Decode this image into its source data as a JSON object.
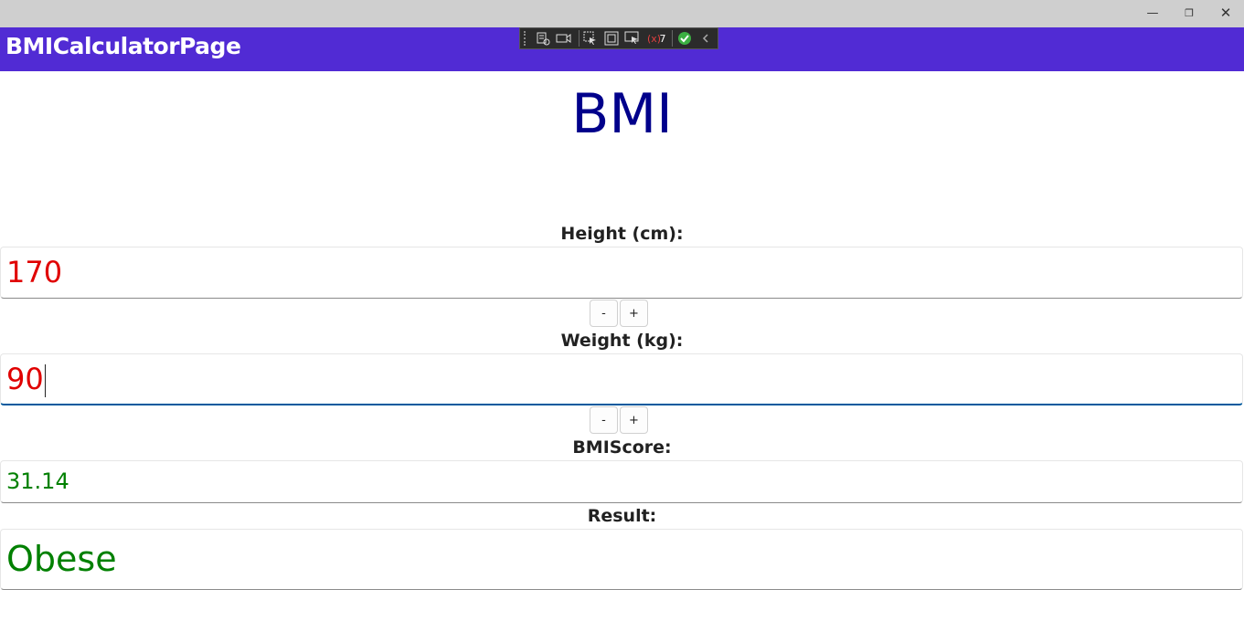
{
  "window": {
    "minimize_glyph": "—",
    "restore_glyph": "❐",
    "close_glyph": "✕"
  },
  "navbar": {
    "title": "BMICalculatorPage"
  },
  "devtools": {
    "binding_failures_count": "7"
  },
  "page": {
    "heading": "BMI",
    "height_label": "Height (cm):",
    "height_value": "170",
    "weight_label": "Weight (kg):",
    "weight_value": "90",
    "minus_label": "-",
    "plus_label": "+",
    "score_label": "BMIScore:",
    "score_value": "31.14",
    "result_label": "Result:",
    "result_value": "Obese"
  },
  "colors": {
    "navbar": "#512bd4",
    "heading": "#00008b",
    "input_text": "#e00000",
    "output_text": "#008000"
  }
}
